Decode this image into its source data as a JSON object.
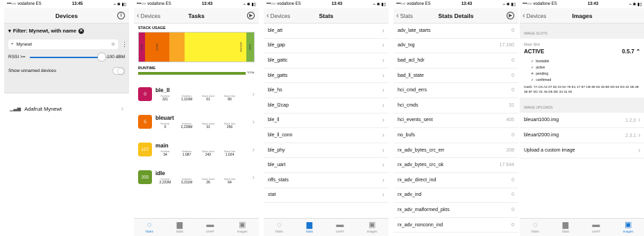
{
  "status_bars": [
    {
      "carrier": "•••○○ vodafone ES",
      "time": "13:45",
      "right": "⌁ ✱ ▮▯"
    },
    {
      "carrier": "•••○○ vodafone ES",
      "time": "13:43",
      "right": "⌁ ✱ ▮▯"
    },
    {
      "carrier": "•••○○ vodafone ES",
      "time": "13:43",
      "right": "⌁ ✱ ▮▯"
    },
    {
      "carrier": "•••○○ vodafone ES",
      "time": "13:43",
      "right": "⌁ ✱ ▮▯"
    },
    {
      "carrier": "•••○○ vodafone ES",
      "time": "13:43",
      "right": "⌁ ✱ ▮▯"
    }
  ],
  "devices": {
    "title": "Devices",
    "filter_label": "Filter: Mynewt, with name",
    "search_value": "Mynewt",
    "rssi_label": "RSSI >=",
    "rssi_value": "-100 dBM",
    "rssi_level": 0.95,
    "unnamed_label": "Show unnamed devices",
    "device_name": "Adafruit Mynewt"
  },
  "tasks": {
    "title": "Tasks",
    "back": "Devices",
    "stack_label": "STACK USAGE",
    "runtime_label": "RUNTIME",
    "total_label": "TOTAL",
    "stack_segments": [
      {
        "label": "61/80",
        "color": "#c2185b",
        "share": 0.05
      },
      {
        "label": "31/256",
        "color": "#ef6c00",
        "share": 0.22
      },
      {
        "label": "",
        "color": "#f9a825",
        "share": 0.14
      },
      {
        "label": "",
        "color": "#fff231",
        "share": 0.46
      },
      {
        "label": "242/1024",
        "color": "#fff231",
        "share": 0.06
      },
      {
        "label": "26/64",
        "color": "#7cb342",
        "share": 0.07
      }
    ],
    "col_headers": [
      "Runtime",
      "Switches",
      "Stack Used",
      "Stack Size"
    ],
    "items": [
      {
        "id": "0",
        "name": "ble_ll",
        "color": "#c2185b",
        "runtime": "321",
        "switches": "1,116M",
        "used": "61",
        "size": "80"
      },
      {
        "id": "5",
        "name": "bleuart",
        "color": "#ef6c00",
        "runtime": "0",
        "switches": "2,228M",
        "used": "31",
        "size": "256"
      },
      {
        "id": "127",
        "name": "main",
        "color": "#f9c21a",
        "runtime": "34",
        "switches": "1.087",
        "used": "242",
        "size": "1.024"
      },
      {
        "id": "255",
        "name": "idle",
        "color": "#6a9a2a",
        "runtime": "2,222M",
        "switches": "3,311M",
        "used": "26",
        "size": "64"
      }
    ]
  },
  "stats": {
    "title": "Stats",
    "back": "Devices",
    "items": [
      "ble_att",
      "ble_gap",
      "ble_gattc",
      "ble_gatts",
      "ble_hs",
      "ble_l2cap",
      "ble_ll",
      "ble_ll_conn",
      "ble_phy",
      "ble_uart",
      "nffs_stats",
      "stat"
    ]
  },
  "stats_details": {
    "title": "Stats Details",
    "back": "Stats",
    "items": [
      {
        "k": "adv_late_starts",
        "v": "0"
      },
      {
        "k": "adv_txg",
        "v": "17.160"
      },
      {
        "k": "bad_acl_hdr",
        "v": "0"
      },
      {
        "k": "bad_ll_state",
        "v": "0"
      },
      {
        "k": "hci_cmd_errs",
        "v": "0"
      },
      {
        "k": "hci_cmds",
        "v": "31"
      },
      {
        "k": "hci_events_sent",
        "v": "405"
      },
      {
        "k": "no_bufs",
        "v": "0"
      },
      {
        "k": "rx_adv_bytes_crc_err",
        "v": "208"
      },
      {
        "k": "rx_adv_bytes_crc_ok",
        "v": "17.644"
      },
      {
        "k": "rx_adv_direct_ind",
        "v": "0"
      },
      {
        "k": "rx_adv_ind",
        "v": "0"
      },
      {
        "k": "rx_adv_malformed_pkts",
        "v": "0"
      },
      {
        "k": "rx_adv_nonconn_ind",
        "v": "0"
      }
    ]
  },
  "images": {
    "title": "Images",
    "back": "Devices",
    "slots_label": "IMAGE SLOTS",
    "main_slot": "Main Slot",
    "slot_status": "ACTIVE",
    "slot_version": "0.5.7",
    "flags": [
      {
        "mark": "✓",
        "text": "bootable"
      },
      {
        "mark": "✓",
        "text": "active"
      },
      {
        "mark": "✕",
        "text": "pending"
      },
      {
        "mark": "✓",
        "text": "confirmed"
      }
    ],
    "hash": "Hash: 7A C6 A2 07 82 23 5A 76 E1 17 87 CB 86 53 48 B0 D0 64 D3 42 4B 38 38 5F DC 01 45 D5 DE 34 31 92",
    "uploads_label": "IMAGE UPLOADS",
    "uploads": [
      {
        "name": "bleuart1000.img",
        "ver": "1.2.0"
      },
      {
        "name": "bleuart2000.img",
        "ver": "2.3.1"
      },
      {
        "name": "Upload a custom image",
        "ver": ""
      }
    ]
  },
  "tab_labels": [
    "Tasks",
    "Stats",
    "UART",
    "Images"
  ]
}
